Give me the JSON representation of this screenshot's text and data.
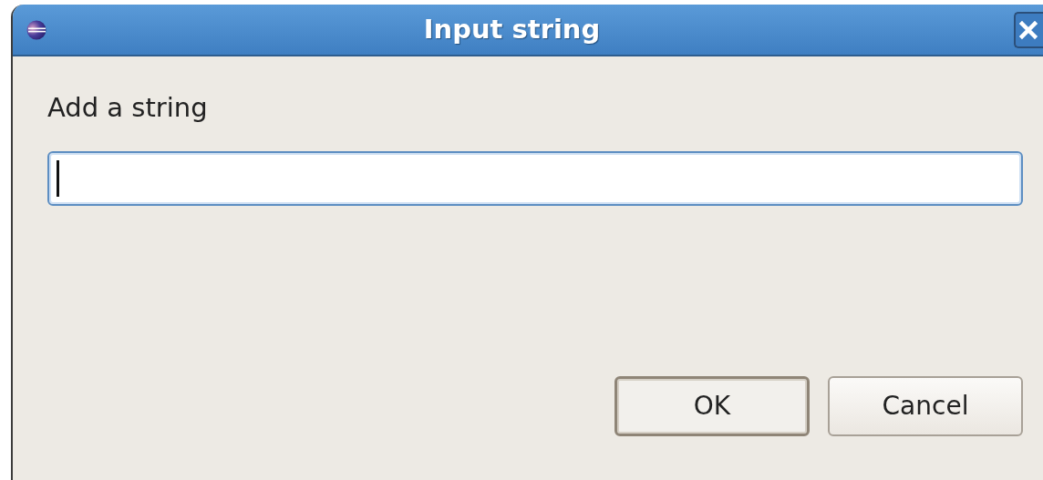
{
  "window": {
    "title": "Input string"
  },
  "prompt": {
    "label": "Add a string"
  },
  "buttons": [
    {
      "label": "OK",
      "default": true
    },
    {
      "label": "Cancel",
      "default": false
    }
  ]
}
